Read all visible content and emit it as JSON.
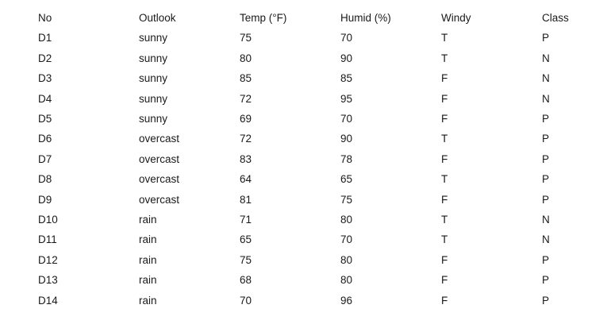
{
  "table": {
    "headers": [
      "No",
      "Outlook",
      "Temp (°F)",
      "Humid (%)",
      "Windy",
      "Class"
    ],
    "rows": [
      [
        "D1",
        "sunny",
        "75",
        "70",
        "T",
        "P"
      ],
      [
        "D2",
        "sunny",
        "80",
        "90",
        "T",
        "N"
      ],
      [
        "D3",
        "sunny",
        "85",
        "85",
        "F",
        "N"
      ],
      [
        "D4",
        "sunny",
        "72",
        "95",
        "F",
        "N"
      ],
      [
        "D5",
        "sunny",
        "69",
        "70",
        "F",
        "P"
      ],
      [
        "D6",
        "overcast",
        "72",
        "90",
        "T",
        "P"
      ],
      [
        "D7",
        "overcast",
        "83",
        "78",
        "F",
        "P"
      ],
      [
        "D8",
        "overcast",
        "64",
        "65",
        "T",
        "P"
      ],
      [
        "D9",
        "overcast",
        "81",
        "75",
        "F",
        "P"
      ],
      [
        "D10",
        "rain",
        "71",
        "80",
        "T",
        "N"
      ],
      [
        "D11",
        "rain",
        "65",
        "70",
        "T",
        "N"
      ],
      [
        "D12",
        "rain",
        "75",
        "80",
        "F",
        "P"
      ],
      [
        "D13",
        "rain",
        "68",
        "80",
        "F",
        "P"
      ],
      [
        "D14",
        "rain",
        "70",
        "96",
        "F",
        "P"
      ]
    ]
  }
}
